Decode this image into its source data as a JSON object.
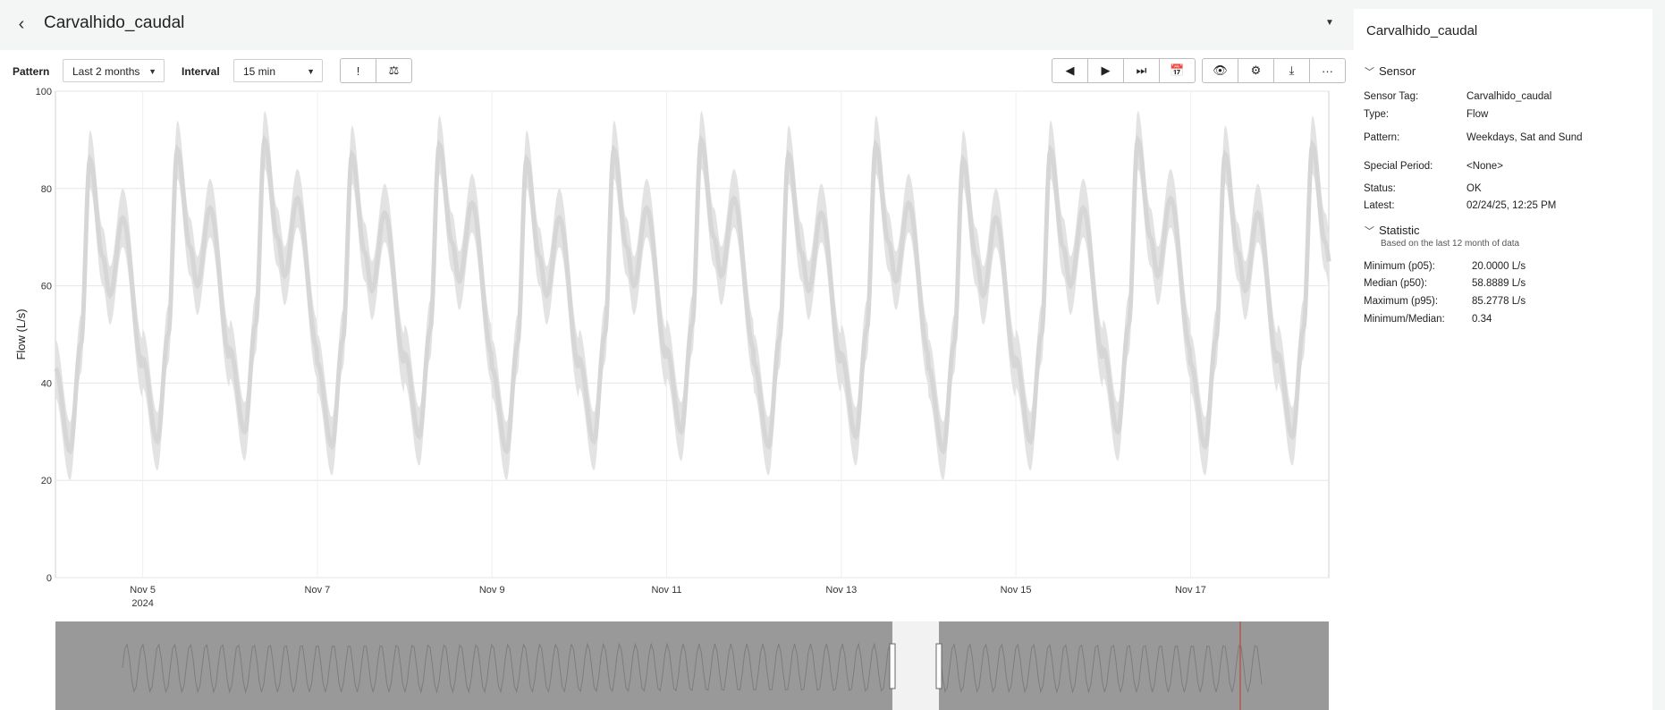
{
  "header": {
    "title": "Carvalhido_caudal"
  },
  "toolbar": {
    "pattern_label": "Pattern",
    "pattern_value": "Last 2 months",
    "interval_label": "Interval",
    "interval_value": "15 min",
    "left_buttons": [
      {
        "name": "alert-icon",
        "glyph": "!"
      },
      {
        "name": "scale-icon",
        "glyph": "⚖"
      }
    ],
    "nav_buttons": [
      {
        "name": "previous-icon",
        "glyph": "◀"
      },
      {
        "name": "play-icon",
        "glyph": "▶"
      },
      {
        "name": "skip-end-icon",
        "glyph": "⏭"
      },
      {
        "name": "calendar-icon",
        "glyph": "📅"
      }
    ],
    "action_buttons": [
      {
        "name": "eye-icon",
        "glyph": "👁"
      },
      {
        "name": "gear-icon",
        "glyph": "⚙"
      },
      {
        "name": "download-icon",
        "glyph": "⤓"
      },
      {
        "name": "more-icon",
        "glyph": "···"
      }
    ]
  },
  "chart_data": {
    "type": "area",
    "ylabel": "Flow (L/s)",
    "ylim": [
      0,
      100
    ],
    "y_ticks": [
      0,
      20,
      40,
      60,
      80,
      100
    ],
    "x_start": "2024-11-04",
    "x_end": "2024-11-18T14:00",
    "x_ticks": [
      {
        "date": "2024-11-05",
        "label": "Nov 5",
        "sublabel": "2024"
      },
      {
        "date": "2024-11-07",
        "label": "Nov 7"
      },
      {
        "date": "2024-11-09",
        "label": "Nov 9"
      },
      {
        "date": "2024-11-11",
        "label": "Nov 11"
      },
      {
        "date": "2024-11-13",
        "label": "Nov 13"
      },
      {
        "date": "2024-11-15",
        "label": "Nov 15"
      },
      {
        "date": "2024-11-17",
        "label": "Nov 17"
      }
    ],
    "daily_pattern": {
      "morning_peak": 88,
      "midday_dip": 60,
      "evening_peak": 76,
      "night_min": 28
    },
    "grid": true,
    "series_color": "#d6d6d6",
    "navigator": {
      "background": "#999999",
      "window": [
        "2024-11-04",
        "2024-11-18T14:00"
      ]
    }
  },
  "panel": {
    "title": "Carvalhido_caudal",
    "sensor_section": "Sensor",
    "sensor": [
      {
        "label": "Sensor Tag:",
        "value": "Carvalhido_caudal"
      },
      {
        "label": "Type:",
        "value": "Flow"
      },
      {
        "label": "Pattern:",
        "value": "Weekdays, Sat and Sund"
      },
      {
        "label": "Special Period:",
        "value": "<None>"
      },
      {
        "label": "Status:",
        "value": "OK"
      },
      {
        "label": "Latest:",
        "value": "02/24/25, 12:25 PM"
      }
    ],
    "statistic_section": "Statistic",
    "statistic_note": "Based on the last 12 month of data",
    "statistics": [
      {
        "label": "Minimum (p05):",
        "value": "20.0000 L/s"
      },
      {
        "label": "Median (p50):",
        "value": "58.8889 L/s"
      },
      {
        "label": "Maximum (p95):",
        "value": "85.2778 L/s"
      },
      {
        "label": "Minimum/Median:",
        "value": "0.34"
      }
    ]
  }
}
